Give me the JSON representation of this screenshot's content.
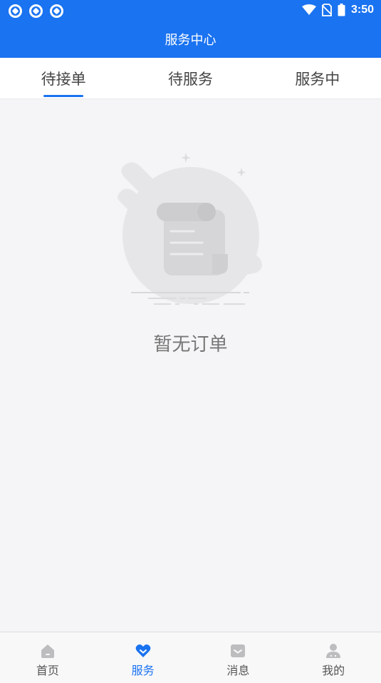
{
  "status_bar": {
    "time": "3:50",
    "left_icons": [
      "app-icon",
      "app-icon",
      "app-icon"
    ],
    "right_icons": [
      "wifi-icon",
      "no-sim-icon",
      "battery-icon"
    ]
  },
  "header": {
    "title": "服务中心",
    "background_color": "#1a73f0"
  },
  "tabs": [
    {
      "label": "待接单",
      "active": true
    },
    {
      "label": "待服务",
      "active": false
    },
    {
      "label": "服务中",
      "active": false
    }
  ],
  "empty_state": {
    "message": "暂无订单",
    "icon": "empty-document-icon"
  },
  "bottom_nav": [
    {
      "label": "首页",
      "icon": "home-icon",
      "active": false
    },
    {
      "label": "服务",
      "icon": "heart-icon",
      "active": true
    },
    {
      "label": "消息",
      "icon": "message-icon",
      "active": false
    },
    {
      "label": "我的",
      "icon": "user-icon",
      "active": false
    }
  ],
  "colors": {
    "accent": "#1a73f0",
    "page_background": "#f5f4f6"
  }
}
